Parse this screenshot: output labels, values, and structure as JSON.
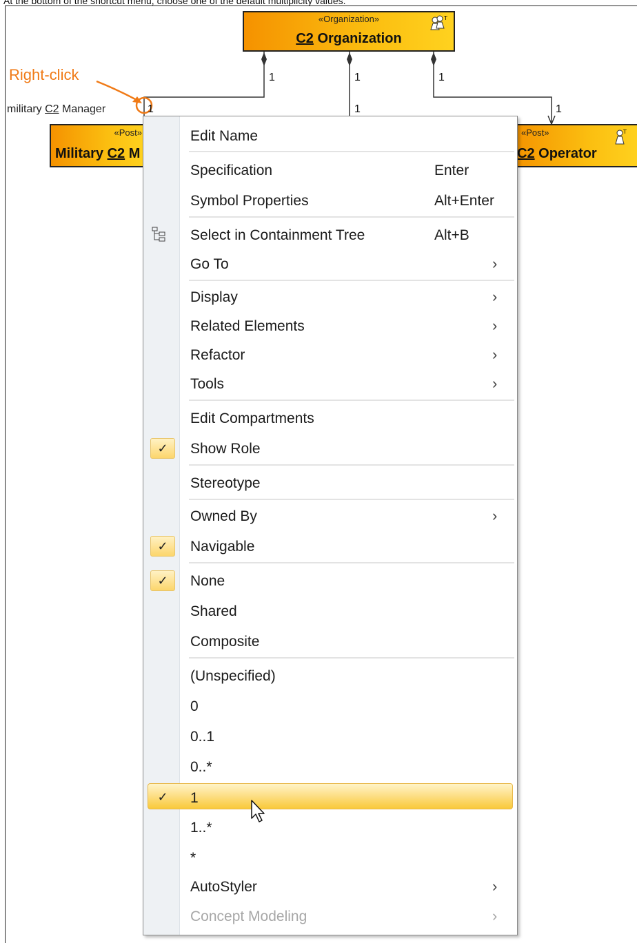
{
  "caption": "At the bottom of the shortcut menu, choose one of the default multiplicity values.",
  "annotation": "Right-click",
  "diagram": {
    "organization": {
      "stereotype": "«Organization»",
      "name_prefix": "C2",
      "name_suffix": " Organization",
      "icon": "organization-icon"
    },
    "left_post": {
      "stereotype": "«Post»",
      "name_plain": "Military ",
      "name_prefix": "C2",
      "name_suffix": " M"
    },
    "right_post": {
      "stereotype": "«Post»",
      "name_prefix": "C2",
      "name_suffix": " Operator",
      "icon": "post-icon"
    },
    "role_label": {
      "plain": "military ",
      "prefix": "C2",
      "suffix": " Manager"
    },
    "multiplicities": {
      "m1": "1",
      "m2": "1",
      "m3": "1",
      "m4": "1",
      "m5": "1",
      "m6": "1"
    }
  },
  "menu": {
    "edit_name": "Edit Name",
    "specification": "Specification",
    "specification_shortcut": "Enter",
    "symbol_properties": "Symbol Properties",
    "symbol_properties_shortcut": "Alt+Enter",
    "select_in_tree": "Select in Containment Tree",
    "select_in_tree_shortcut": "Alt+B",
    "go_to": "Go To",
    "display": "Display",
    "related_elements": "Related Elements",
    "refactor": "Refactor",
    "tools": "Tools",
    "edit_compartments": "Edit Compartments",
    "show_role": "Show Role",
    "stereotype": "Stereotype",
    "owned_by": "Owned By",
    "navigable": "Navigable",
    "none": "None",
    "shared": "Shared",
    "composite": "Composite",
    "unspecified": "(Unspecified)",
    "mult_0": "0",
    "mult_0_1": "0..1",
    "mult_0_star": "0..*",
    "mult_1": "1",
    "mult_1_star": "1..*",
    "mult_star": "*",
    "autostyler": "AutoStyler",
    "concept_modeling": "Concept Modeling",
    "submenu_arrow": "›",
    "check_mark": "✓",
    "checked": {
      "show_role": true,
      "navigable": true,
      "none": true,
      "mult_1": true
    },
    "highlighted_item": "1",
    "disabled_item": "Concept Modeling"
  },
  "colors": {
    "block_start": "#f59200",
    "block_end": "#ffd21f",
    "annotation": "#f07a16",
    "highlight": "#fde08a"
  }
}
